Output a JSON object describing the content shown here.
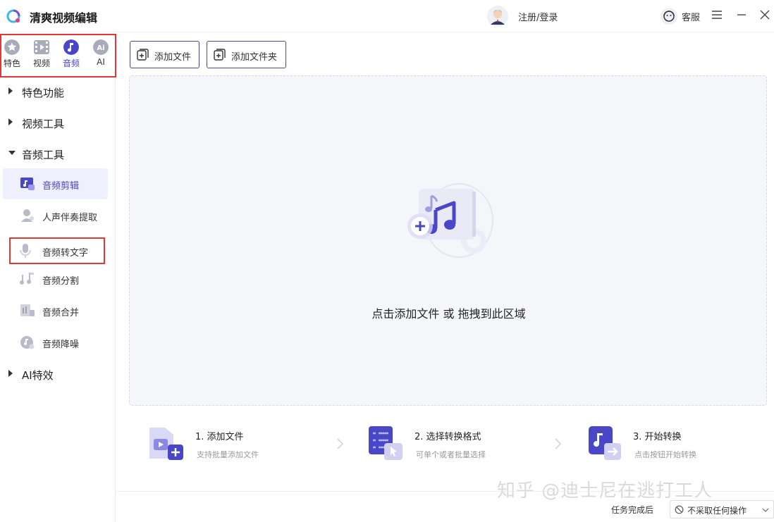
{
  "app": {
    "title": "清爽视频编辑",
    "login": "注册/登录",
    "service": "客服"
  },
  "categories": [
    {
      "label": "特色",
      "icon": "star-icon"
    },
    {
      "label": "视频",
      "icon": "film-icon"
    },
    {
      "label": "音频",
      "icon": "music-note-icon",
      "active": true
    },
    {
      "label": "AI",
      "icon": "ai-icon"
    }
  ],
  "groups": [
    {
      "label": "特色功能",
      "expanded": false
    },
    {
      "label": "视频工具",
      "expanded": false
    },
    {
      "label": "音频工具",
      "expanded": true
    },
    {
      "label": "AI特效",
      "expanded": false
    }
  ],
  "audio_tools": [
    {
      "label": "音频剪辑",
      "icon": "audio-clip-icon",
      "active": true
    },
    {
      "label": "人声伴奏提取",
      "icon": "vocal-extract-icon"
    },
    {
      "label": "音频转文字",
      "icon": "microphone-icon",
      "highlighted": true
    },
    {
      "label": "音频分割",
      "icon": "audio-split-icon"
    },
    {
      "label": "音频合并",
      "icon": "audio-merge-icon"
    },
    {
      "label": "音频降噪",
      "icon": "noise-reduce-icon"
    }
  ],
  "toolbar": {
    "add_file": "添加文件",
    "add_folder": "添加文件夹"
  },
  "dropzone": {
    "text": "点击添加文件 或 拖拽到此区域"
  },
  "steps": [
    {
      "title": "1. 添加文件",
      "subtitle": "支持批量添加文件"
    },
    {
      "title": "2. 选择转换格式",
      "subtitle": "可单个或者批量选择"
    },
    {
      "title": "3. 开始转换",
      "subtitle": "点击按钮开始转换"
    }
  ],
  "footer": {
    "after_label": "任务完成后",
    "after_value": "不采取任何操作"
  },
  "watermark": "知乎 @迪士尼在逃打工人",
  "colors": {
    "accent": "#4a46c8",
    "highlight_border": "#e53535",
    "dropzone_bg": "#f5f6fa"
  }
}
